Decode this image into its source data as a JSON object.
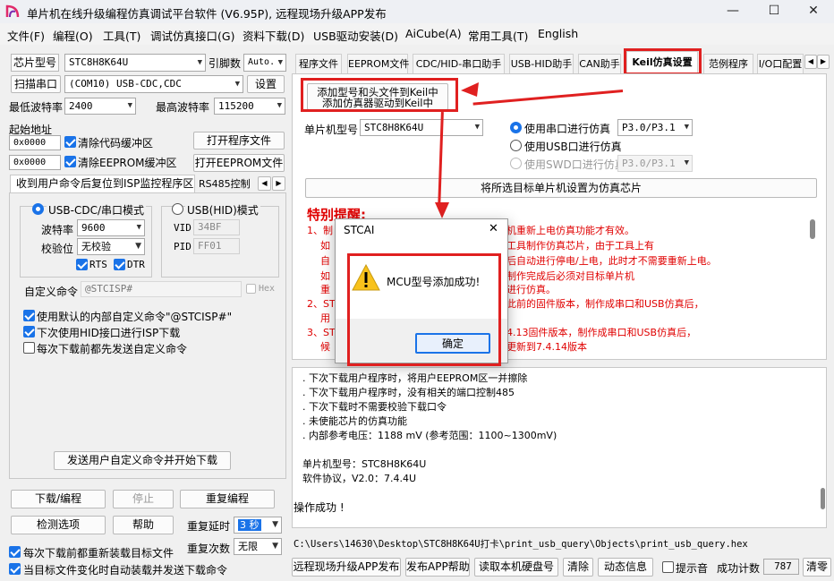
{
  "window": {
    "title": "单片机在线升级编程仿真调试平台软件 (V6.95P), 远程现场升级APP发布",
    "min": "—",
    "max": "☐",
    "close": "✕"
  },
  "menu": [
    "文件(F)",
    "编程(O)",
    "工具(T)",
    "调试仿真接口(G)",
    "资料下载(D)",
    "USB驱动安装(D)",
    "AiCube(A)",
    "常用工具(T)",
    "English"
  ],
  "left": {
    "chip_label": "芯片型号",
    "chip_value": "STC8H8K64U",
    "pin_label": "引脚数",
    "pin_value": "Auto.",
    "scan_btn": "扫描串口",
    "port_value": "(COM10) USB-CDC,CDC",
    "settings_btn": "设置",
    "minbaud_label": "最低波特率",
    "minbaud_value": "2400",
    "maxbaud_label": "最高波特率",
    "maxbaud_value": "115200",
    "start_label": "起始地址",
    "addr1": "0x0000",
    "clear_code": "清除代码缓冲区",
    "open_prog": "打开程序文件",
    "addr2": "0x0000",
    "clear_eeprom": "清除EEPROM缓冲区",
    "open_eeprom": "打开EEPROM文件",
    "tab1": "收到用户命令后复位到ISP监控程序区",
    "tab2": "RS485控制",
    "cdc_mode": "USB-CDC/串口模式",
    "hid_mode": "USB(HID)模式",
    "baud_label": "波特率",
    "baud_value": "9600",
    "vid_label": "VID",
    "vid_value": "34BF",
    "parity_label": "校验位",
    "parity_value": "无校验",
    "pid_label": "PID",
    "pid_value": "FF01",
    "rts": "RTS",
    "dtr": "DTR",
    "custom_label": "自定义命令",
    "custom_value": "@STCISP#",
    "hex": "Hex",
    "opt1": "使用默认的内部自定义命令\"@STCISP#\"",
    "opt2": "下次使用HID接口进行ISP下载",
    "opt3": "每次下载前都先发送自定义命令",
    "send_btn": "发送用户自定义命令并开始下载",
    "download_btn": "下载/编程",
    "stop_btn": "停止",
    "reprog_btn": "重复编程",
    "check_btn": "检测选项",
    "help_btn": "帮助",
    "delay_label": "重复延时",
    "delay_value": "3 秒",
    "count_label": "重复次数",
    "count_value": "无限",
    "reload_opt": "每次下载前都重新装载目标文件",
    "auto_opt": "当目标文件变化时自动装载并发送下载命令"
  },
  "tabs": [
    "程序文件",
    "EEPROM文件",
    "CDC/HID-串口助手",
    "USB-HID助手",
    "CAN助手",
    "Keil仿真设置",
    "范例程序",
    "I/O口配置"
  ],
  "keil": {
    "add_btn1": "添加型号和头文件到Keil中",
    "add_btn2": "添加仿真器驱动到Keil中",
    "mcu_label": "单片机型号",
    "mcu_value": "STC8H8K64U",
    "serial_opt": "使用串口进行仿真",
    "serial_port": "P3.0/P3.1",
    "usb_opt": "使用USB口进行仿真",
    "swd_opt": "使用SWD口进行仿真",
    "swd_port": "P3.0/P3.1",
    "set_btn": "将所选目标单片机设置为仿真芯片",
    "warn_title": "特别提醒:",
    "warn_lines": [
      "1、制",
      "如",
      "自",
      "如",
      "重",
      "2、ST",
      "用",
      "3、ST",
      "候"
    ],
    "warn_tail": [
      "机重新上电仿真功能才有效。",
      "工具制作仿真芯片，由于工具上有",
      "后自动进行停电/上电，此时才不需要重新上电。",
      "制作完成后必须对目标单片机",
      "进行仿真。",
      "此前的固件版本，制作成串口和USB仿真后，",
      "",
      "4.13固件版本，制作成串口和USB仿真后，",
      "更新到7.4.14版本"
    ]
  },
  "log": {
    "lines": [
      ". 下次下载用户程序时，将用户EEPROM区一并擦除",
      ". 下次下载用户程序时，没有相关的端口控制485",
      ". 下次下载时不需要校验下载口令",
      ". 未使能芯片的仿真功能",
      ". 内部参考电压：1188 mV (参考范围：1100~1300mV)",
      "",
      "单片机型号：STC8H8K64U",
      "软件协议，V2.0：7.4.4U",
      "",
      "操作成功 !"
    ],
    "path": "C:\\Users\\14630\\Desktop\\STC8H8K64U打卡\\print_usb_query\\Objects\\print_usb_query.hex"
  },
  "bottom": {
    "publish_btn": "远程现场升级APP发布",
    "help_btn": "发布APP帮助",
    "read_btn": "读取本机硬盘号",
    "clear_btn": "清除",
    "anim_btn": "动态信息",
    "beep": "提示音",
    "count_label": "成功计数",
    "count_value": "787",
    "reset_btn": "清零"
  },
  "dialog": {
    "title": "STCAI",
    "message": "MCU型号添加成功!",
    "ok": "确定",
    "close": "✕"
  }
}
